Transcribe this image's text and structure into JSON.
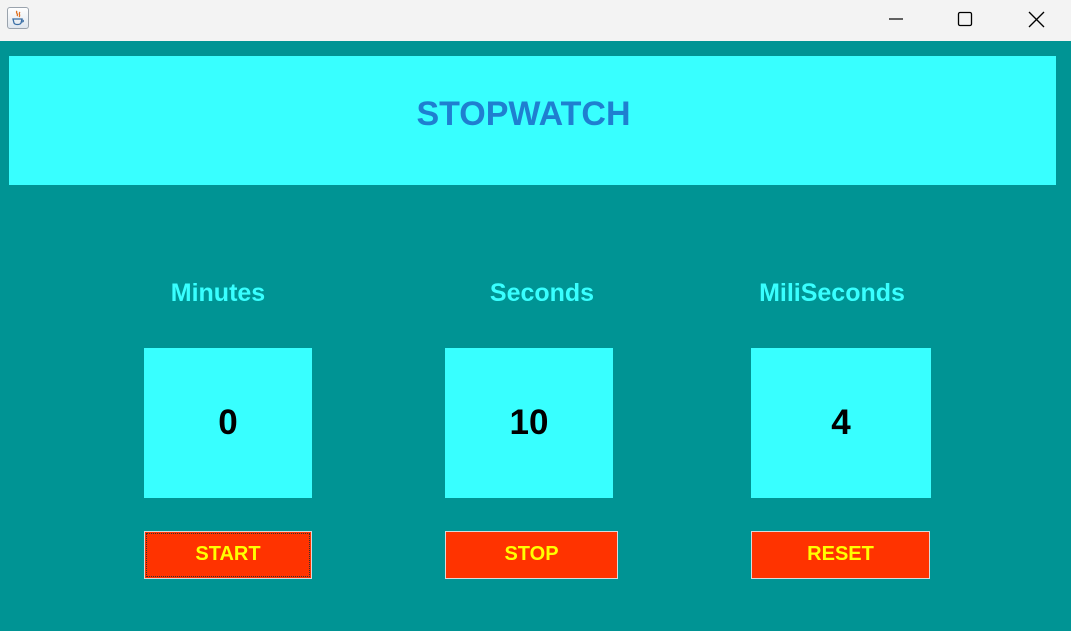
{
  "window": {
    "controls": {
      "minimize_icon": "minimize-icon",
      "maximize_icon": "maximize-icon",
      "close_icon": "close-icon"
    }
  },
  "colors": {
    "background": "#009494",
    "panel": "#38ffff",
    "title_text": "#1f7fd0",
    "label_text": "#38ffff",
    "button_bg": "#ff3300",
    "button_text": "#ffff00"
  },
  "header": {
    "title": "STOPWATCH"
  },
  "stopwatch": {
    "minutes_label": "Minutes",
    "seconds_label": "Seconds",
    "milliseconds_label": "MiliSeconds",
    "minutes_value": "0",
    "seconds_value": "10",
    "milliseconds_value": "4"
  },
  "buttons": {
    "start": "START",
    "stop": "STOP",
    "reset": "RESET"
  }
}
